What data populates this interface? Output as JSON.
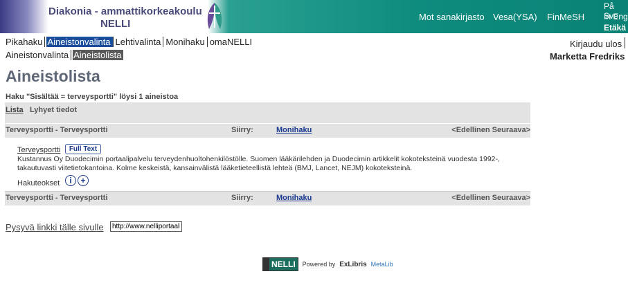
{
  "header": {
    "brand_line1": "Diakonia - ammattikorkeakoulu",
    "brand_line2": "NELLI",
    "nav": [
      "Mot sanakirjasto",
      "Vesa(YSA)",
      "FinMeSH"
    ],
    "lang": [
      "På Sve",
      "In Eng",
      "Etäkä"
    ]
  },
  "tabs_row1": [
    "Pikahaku",
    "Aineistonvalinta",
    "Lehtivalinta",
    "Monihaku",
    "omaNELLI"
  ],
  "tabs_row2": [
    "Aineistonvalinta",
    "Aineistolista"
  ],
  "user": {
    "logout": "Kirjaudu ulos",
    "name": "Marketta Fredriks"
  },
  "page": {
    "title": "Aineistolista",
    "found": "Haku \"Sisältää = terveysportti\" löysi 1 aineistoa",
    "view_lista": "Lista",
    "view_lyhyet": "Lyhyet tiedot"
  },
  "navrow": {
    "dbname": "Terveysportti - Terveysportti",
    "siirry": "Siirry:",
    "monihaku": "Monihaku",
    "pager": "<Edellinen Seuraava>"
  },
  "entry": {
    "title": "Terveysportti",
    "fulltext": "Full Text",
    "description": "Kustannus Oy Duodecimin portaalipalvelu terveydenhuoltohenkilöstölle. Suomen lääkärilehden ja Duodecimin artikkelit kokoteksteinä vuodesta 1992-, takautuvasti viitetietokantoina. Kolme keskeistä, kansainvälistä lääketieteellistä lehteä (BMJ, Lancet, NEJM) kokoteksteinä.",
    "hakuteokset": "Hakuteokset",
    "info_icon_glyph": "i",
    "add_icon_glyph": "+"
  },
  "permalink": {
    "label": "Pysyvä linkki tälle sivulle",
    "value": "http://www.nelliportaali.fi"
  },
  "footer": {
    "nelli": "NELLI",
    "powered": "Powered by",
    "exlibris": "ExLibris",
    "metalib": "MetaLib"
  }
}
